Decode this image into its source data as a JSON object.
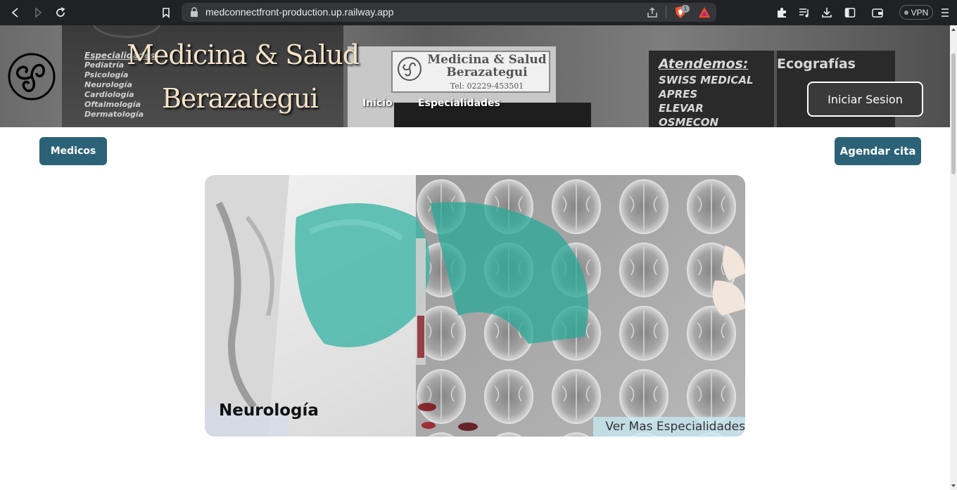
{
  "browser": {
    "url": "medconnectfront-production.up.railway.app",
    "shield_count": "1",
    "vpn_label": "VPN",
    "icons": [
      "back-icon",
      "forward-icon",
      "reload-icon",
      "bookmark-icon",
      "lock-icon",
      "share-icon",
      "brave-shield-icon",
      "rewards-icon",
      "extensions-icon",
      "playlist-icon",
      "download-icon",
      "sidebar-icon",
      "wallet-icon",
      "menu-icon"
    ]
  },
  "header": {
    "brand_line_1": "Medicina & Salud",
    "brand_line_2": "Berazategui",
    "nav": {
      "inicio": "Inicio",
      "especialidades": "Especialidades"
    },
    "login_label": "Iniciar Sesion",
    "banner_photo": {
      "left_sign": [
        "Especialidades",
        "Pediatría",
        "Psicología",
        "Neurología",
        "Cardiología",
        "Oftalmología",
        "Dermatología"
      ],
      "plaque_title": "Medicina & Salud Berazategui",
      "plaque_phone": "Tel: 02229-453501",
      "right_sign_header": "Atendemos:",
      "right_sign_items": [
        "SWISS MEDICAL",
        "APRES",
        "ELEVAR",
        "OSMECON"
      ],
      "right_sign_eco": "Ecografías"
    }
  },
  "actions": {
    "medicos_label": "Medicos",
    "agendar_label": "Agendar cita"
  },
  "hero": {
    "title": "Neurología",
    "more_link": "Ver Mas Especialidades"
  },
  "colors": {
    "primary_button": "#2b6278",
    "brand_title": "#f5e3c8",
    "glove_teal": "#3fb5a6"
  }
}
